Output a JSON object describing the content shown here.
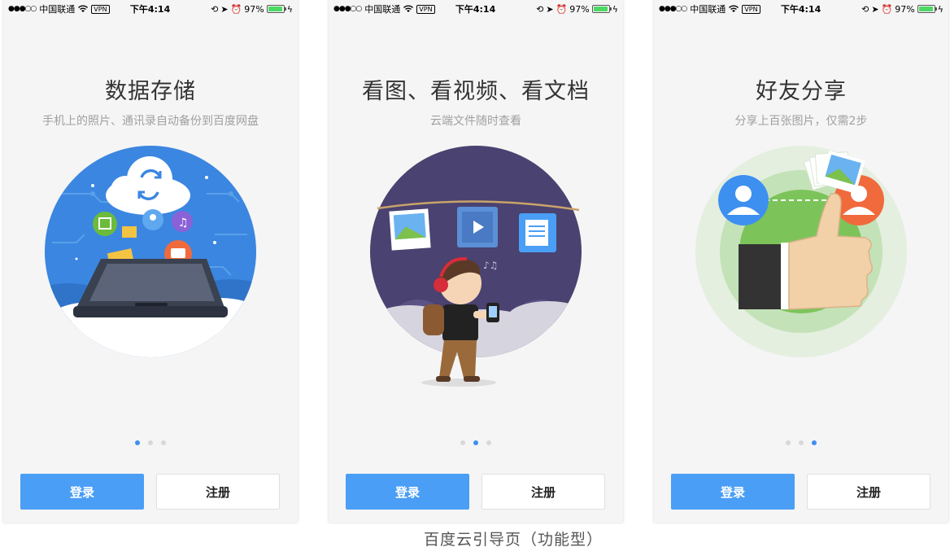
{
  "status_bar": {
    "signal": "●●●○○",
    "carrier": "中国联通",
    "vpn": "VPN",
    "time": "下午4:14",
    "battery": "97%",
    "battery_level": 0.97,
    "battery_color": "#4cd964"
  },
  "screens": [
    {
      "title": "数据存储",
      "subtitle": "手机上的照片、通讯录自动备份到百度网盘",
      "illustration": "cloud-backup-tablet-illustration",
      "active_dot": 0
    },
    {
      "title": "看图、看视频、看文档",
      "subtitle": "云端文件随时查看",
      "illustration": "walking-boy-media-illustration",
      "active_dot": 1
    },
    {
      "title": "好友分享",
      "subtitle": "分享上百张图片，仅需2步",
      "illustration": "thumbs-up-share-illustration",
      "active_dot": 2
    }
  ],
  "buttons": {
    "login": "登录",
    "register": "注册"
  },
  "caption": "百度云引导页（功能型）",
  "colors": {
    "accent": "#4a9ef5",
    "dot_active": "#3d8ff0",
    "dot_inactive": "#d8d8d8",
    "title": "#333333",
    "subtitle": "#a0a0a0"
  }
}
